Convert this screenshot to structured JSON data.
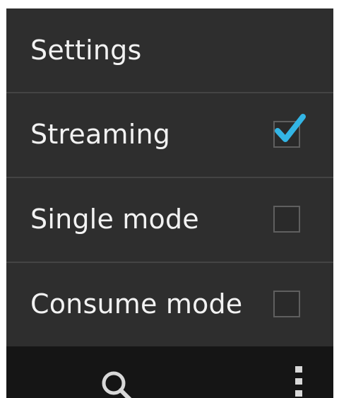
{
  "menu": {
    "title": "Settings",
    "items": [
      {
        "label": "Streaming",
        "checked": true
      },
      {
        "label": "Single mode",
        "checked": false
      },
      {
        "label": "Consume mode",
        "checked": false
      }
    ]
  },
  "nav": {
    "search_icon": "search-icon",
    "overflow_icon": "overflow-menu-icon"
  },
  "colors": {
    "menu_background": "#2e2e2e",
    "divider": "#444444",
    "text": "#f2f2f2",
    "checkbox_border": "#5f5f5f",
    "check_accent": "#33b5e5",
    "nav_background": "#151515",
    "nav_icon": "#d8d8d8"
  }
}
